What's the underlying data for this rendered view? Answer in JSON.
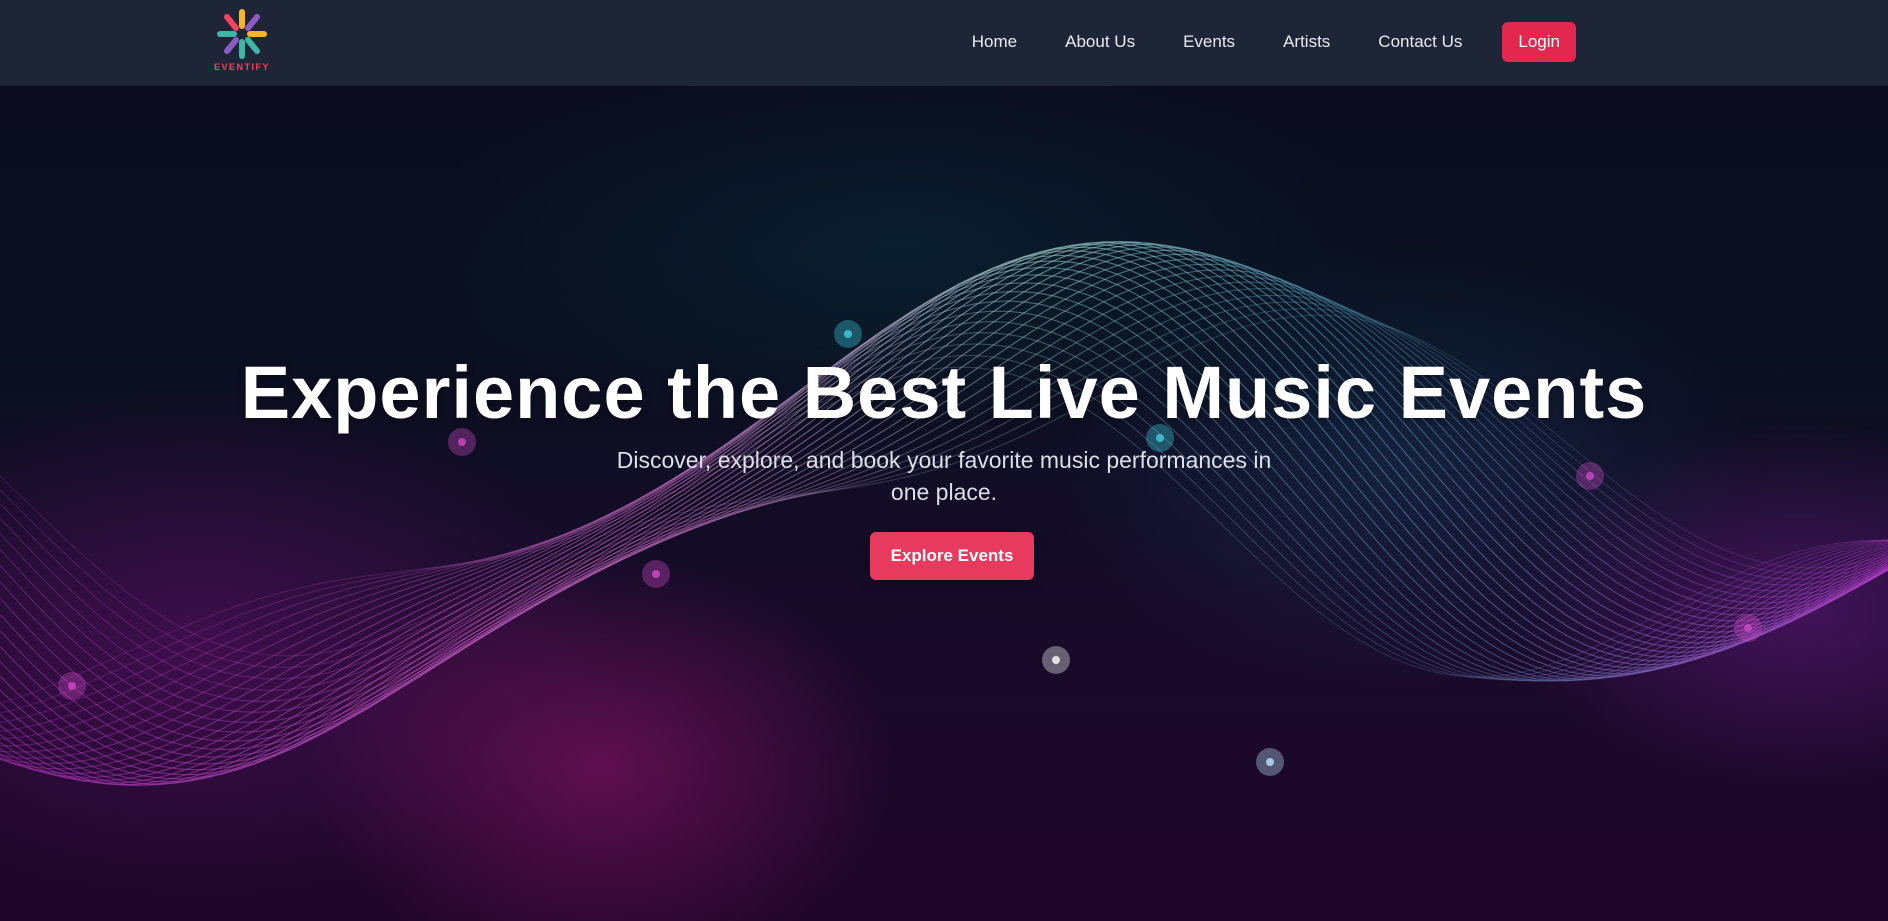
{
  "brand": {
    "name": "EVENTIFY",
    "logo_icon": "asterisk-burst-logo",
    "colors": [
      "#f1435e",
      "#f6b62c",
      "#3fb6a8",
      "#8c5cc4",
      "#e3284f"
    ]
  },
  "nav": {
    "links": [
      {
        "label": "Home"
      },
      {
        "label": "About Us"
      },
      {
        "label": "Events"
      },
      {
        "label": "Artists"
      },
      {
        "label": "Contact Us"
      }
    ],
    "login_label": "Login"
  },
  "hero": {
    "title": "Experience the Best Live Music Events",
    "subtitle": "Discover, explore, and book your favorite music performances in one place.",
    "cta_label": "Explore Events",
    "background": "sound-wave-lines"
  },
  "theme": {
    "navbar_bg": "#1e2537",
    "accent": "#e3284f",
    "cta_bg": "#e83a5e"
  }
}
